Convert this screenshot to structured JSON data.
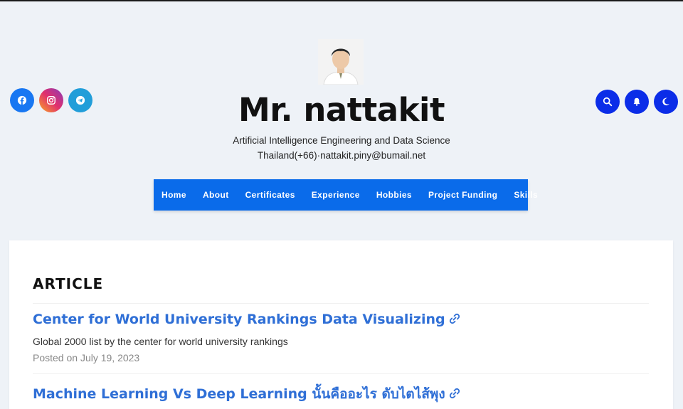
{
  "site": {
    "title": "Mr. nattakit",
    "tagline": "Artificial Intelligence Engineering and Data Science",
    "contact": "Thailand(+66)·nattakit.piny@bumail.net"
  },
  "social_icons": [
    "facebook-icon",
    "instagram-icon",
    "telegram-icon"
  ],
  "action_icons": [
    "search-icon",
    "bell-icon",
    "moon-icon"
  ],
  "nav": {
    "items": [
      "Home",
      "About",
      "Certificates",
      "Experience",
      "Hobbies",
      "Project Funding",
      "Skills"
    ]
  },
  "section": {
    "title": "ARTICLE"
  },
  "posts": [
    {
      "title": "Center for World University Rankings Data Visualizing",
      "excerpt": "Global 2000 list by the center for world university rankings",
      "meta": "Posted on July 19, 2023"
    },
    {
      "title": "Machine Learning Vs Deep Learning นั้นคืออะไร ดับไตไส้พุง"
    }
  ],
  "colors": {
    "accent": "#0a6bea",
    "action_button": "#0b2de8",
    "link": "#2f6fd6",
    "background": "#eef2f7"
  }
}
